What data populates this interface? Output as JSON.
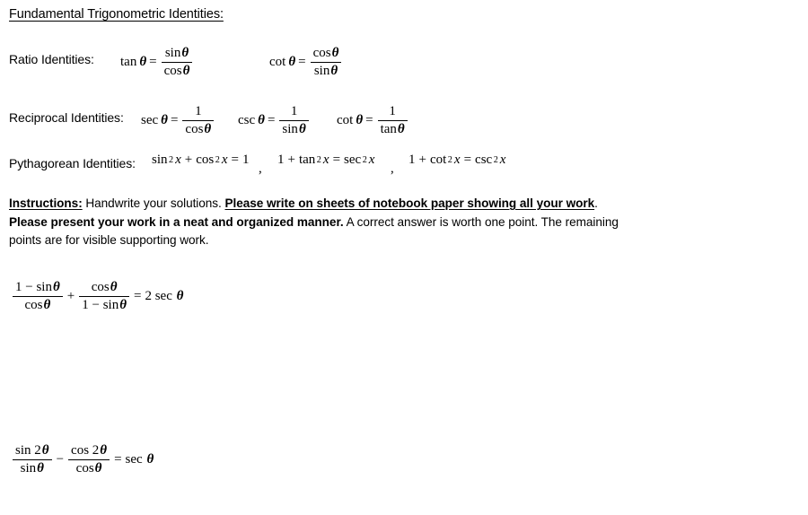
{
  "document": {
    "title": "Fundamental Trigonometric Identities:"
  },
  "identities": {
    "ratio": {
      "label": "Ratio Identities:",
      "items": [
        {
          "name": "tangent-ratio-identity",
          "lhs_fn": "tan",
          "lhs_arg": "θ",
          "relation": "=",
          "numerator": "sin θ",
          "denominator": "cos θ"
        },
        {
          "name": "cotangent-ratio-identity",
          "lhs_fn": "cot",
          "lhs_arg": "θ",
          "relation": "=",
          "numerator": "cos θ",
          "denominator": "sin θ"
        }
      ]
    },
    "reciprocal": {
      "label": "Reciprocal Identities:",
      "items": [
        {
          "name": "secant-reciprocal-identity",
          "lhs_fn": "sec",
          "lhs_arg": "θ",
          "relation": "=",
          "numerator": "1",
          "denominator": "cos θ"
        },
        {
          "name": "cosecant-reciprocal-identity",
          "lhs_fn": "csc",
          "lhs_arg": "θ",
          "relation": "=",
          "numerator": "1",
          "denominator": "sin θ"
        },
        {
          "name": "cotangent-reciprocal-identity",
          "lhs_fn": "cot",
          "lhs_arg": "θ",
          "relation": "=",
          "numerator": "1",
          "denominator": "tan θ"
        }
      ]
    },
    "pythagorean": {
      "label": "Pythagorean Identities:",
      "items": [
        {
          "name": "pythagorean-identity-1",
          "text": "sin² x + cos² x = 1",
          "terms": [
            "sin",
            "2",
            "x",
            "+",
            "cos",
            "2",
            "x",
            "=",
            "1"
          ],
          "separator": ","
        },
        {
          "name": "pythagorean-identity-2",
          "text": "1 + tan² x = sec² x",
          "terms": [
            "1",
            "+",
            "tan",
            "2",
            "x",
            "=",
            "sec",
            "2",
            "x"
          ],
          "separator": ","
        },
        {
          "name": "pythagorean-identity-3",
          "text": "1 + cot² x = csc² x",
          "terms": [
            "1",
            "+",
            "cot",
            "2",
            "x",
            "=",
            "csc",
            "2",
            "x"
          ],
          "separator": ""
        }
      ]
    }
  },
  "instructions": {
    "label": "Instructions:",
    "segment_plain_1": " Handwrite your solutions. ",
    "segment_bold_underline": "Please write on sheets of notebook paper showing all your work",
    "segment_plain_2": ". ",
    "segment_bold": "Please present your work in a neat and organized manner.",
    "segment_plain_3": " A correct answer is worth one point. The remaining points are for visible supporting work."
  },
  "problems": [
    {
      "name": "problem-1",
      "left_fraction_1": {
        "numerator": "1 − sin θ",
        "denominator": "cos θ"
      },
      "operator": "+",
      "left_fraction_2": {
        "numerator": "cos θ",
        "denominator": "1 − sin θ"
      },
      "relation": "=",
      "right_side": "2 sec θ",
      "full_text": "(1 − sin θ)/cos θ + cos θ/(1 − sin θ) = 2 sec θ"
    },
    {
      "name": "problem-2",
      "left_fraction_1": {
        "numerator": "sin 2θ",
        "denominator": "sin θ"
      },
      "operator": "−",
      "left_fraction_2": {
        "numerator": "cos 2θ",
        "denominator": "cos θ"
      },
      "relation": "=",
      "right_side": "sec θ",
      "full_text": "sin 2θ/sin θ − cos 2θ/cos θ = sec θ"
    }
  ]
}
